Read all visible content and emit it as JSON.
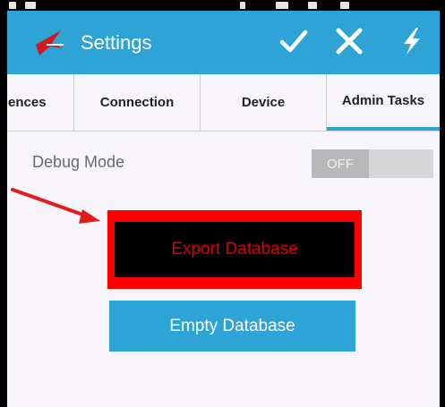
{
  "app": {
    "title": "Settings",
    "icon": "app-logo-icon"
  },
  "actions": {
    "confirm_icon": "check-icon",
    "cancel_icon": "close-icon",
    "extra_icon": "lightning-icon"
  },
  "tabs": [
    {
      "label": "ences"
    },
    {
      "label": "Connection"
    },
    {
      "label": "Device"
    },
    {
      "label": "Admin Tasks",
      "active": true
    }
  ],
  "debug": {
    "label": "Debug Mode",
    "toggle_state": "OFF"
  },
  "buttons": {
    "export": "Export Database",
    "empty": "Empty Database"
  },
  "colors": {
    "accent": "#2ea3d6",
    "highlight": "#ff0000",
    "export_text": "#d80000"
  }
}
